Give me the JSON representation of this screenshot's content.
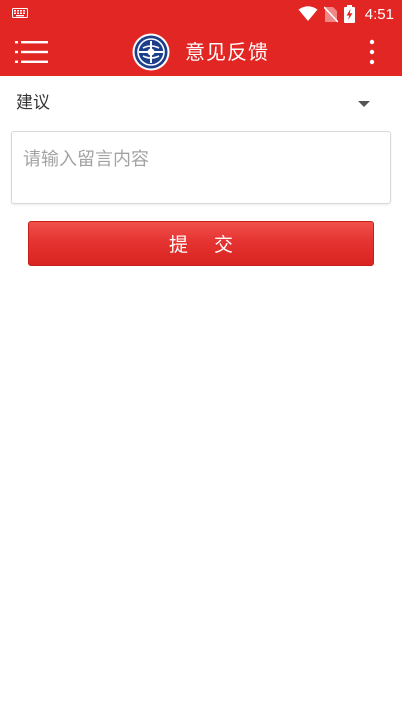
{
  "status_bar": {
    "time": "4:51",
    "icons": [
      "keyboard-icon",
      "wifi-icon",
      "no-sim-icon",
      "battery-charging-icon"
    ]
  },
  "app_bar": {
    "title": "意见反馈",
    "background_color": "#e22624",
    "icons": [
      "menu-icon",
      "app-logo",
      "more-vert-icon"
    ]
  },
  "form": {
    "category": {
      "selected": "建议"
    },
    "message": {
      "value": "",
      "placeholder": "请输入留言内容"
    },
    "submit_label": "提 交",
    "button_color": "#e53432"
  }
}
